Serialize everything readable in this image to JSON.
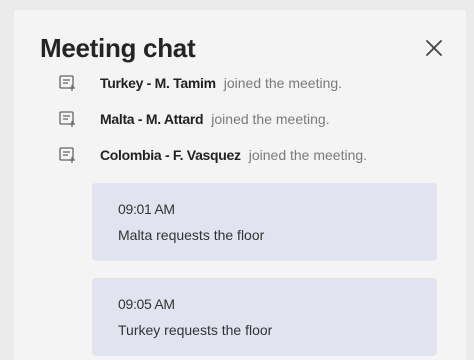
{
  "chat": {
    "title": "Meeting chat",
    "events": [
      {
        "icon": "roster-join-icon",
        "name": "Turkey - M. Tamim",
        "text": "joined the meeting."
      },
      {
        "icon": "roster-join-icon",
        "name": "Malta - M. Attard",
        "text": "joined the meeting."
      },
      {
        "icon": "roster-join-icon",
        "name": "Colombia - F. Vasquez",
        "text": "joined the meeting."
      }
    ],
    "messages": [
      {
        "time": "09:01 AM",
        "text": "Malta requests the floor"
      },
      {
        "time": "09:05 AM",
        "text": "Turkey requests the floor"
      }
    ]
  },
  "colors": {
    "panel": "#f4f4f4",
    "message_bg": "#e1e3ef",
    "name": "#222222",
    "event_text": "#7a7a7a"
  }
}
